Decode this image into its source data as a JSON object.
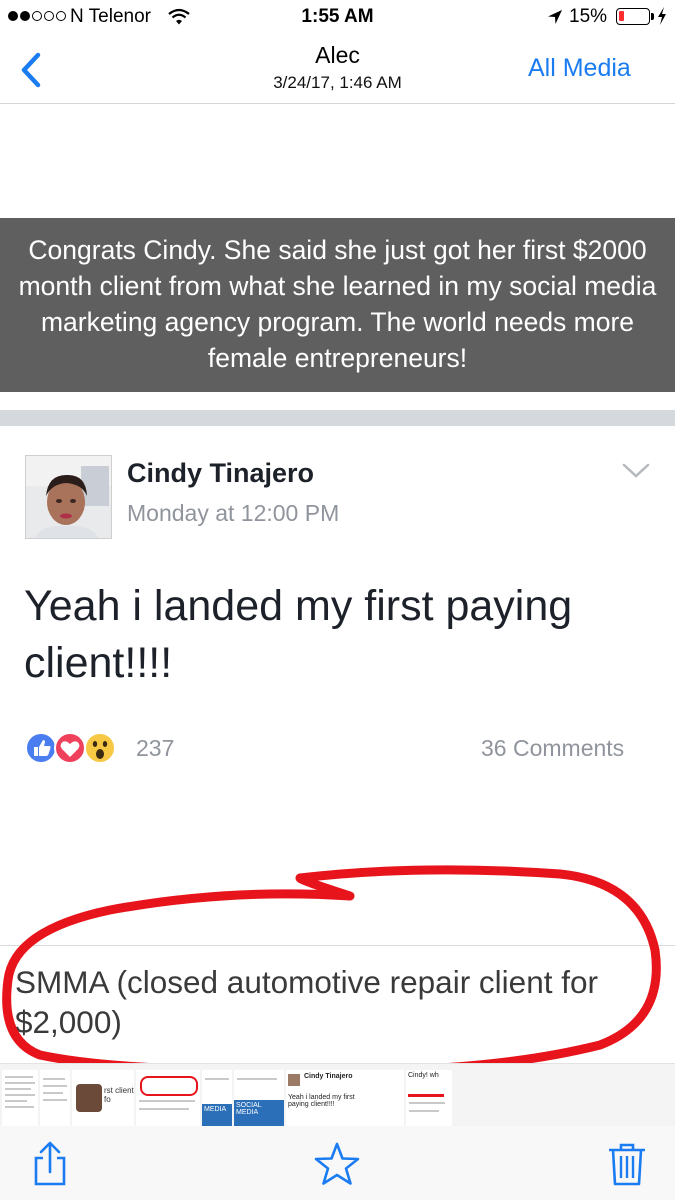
{
  "status_bar": {
    "carrier": "N Telenor",
    "time": "1:55 AM",
    "battery_percent": "15%"
  },
  "nav": {
    "title": "Alec",
    "subtitle": "3/24/17, 1:46 AM",
    "right_button": "All Media"
  },
  "caption": "Congrats Cindy. She said she just got her first $2000 month client from what she learned in my social media marketing agency program. The world needs more female entrepreneurs!",
  "post": {
    "author": "Cindy Tinajero",
    "time": "Monday at 12:00 PM",
    "text": "Yeah i landed my first paying client!!!!",
    "reaction_count": "237",
    "comments": "36 Comments"
  },
  "description": "SMMA (closed automotive repair client for $2,000)",
  "thumbnails": {
    "t3_label": "rst client fo",
    "t5_label": "MEDIA",
    "t6_label": "SOCIAL MEDIA",
    "t7_author": "Cindy Tinajero",
    "t7_text": "Yeah i landed my first paying client!!!!",
    "t8_text": "Cindy! wh"
  },
  "colors": {
    "accent": "#1b7cf2",
    "annotation": "#e8141b",
    "caption_bg": "#5f5f5f"
  },
  "icons": [
    "back-chevron-icon",
    "wifi-icon",
    "location-arrow-icon",
    "battery-icon",
    "chevron-down-icon",
    "like-icon",
    "love-icon",
    "wow-icon",
    "share-icon",
    "star-icon",
    "trash-icon"
  ]
}
